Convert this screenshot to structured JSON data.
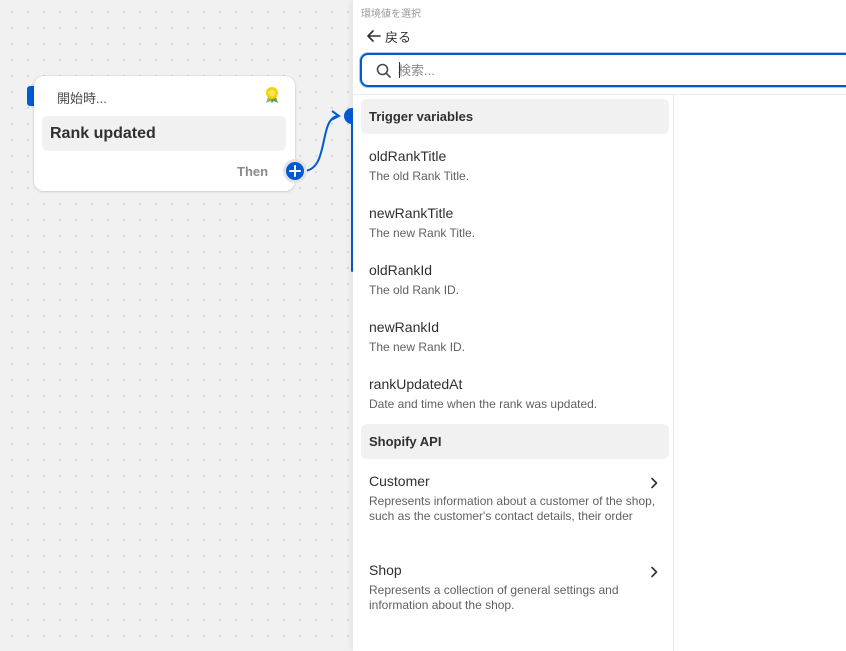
{
  "colors": {
    "accent": "#005bd3",
    "canvas": "#f1f1f1",
    "badge": "#f2d200"
  },
  "trigger": {
    "header_label": "開始時...",
    "title": "Rank updated",
    "then_label": "Then",
    "icon": "award-badge-icon"
  },
  "panel": {
    "hint": "環境値を選択",
    "back_label": "戻る",
    "search": {
      "placeholder": "検索...",
      "value": ""
    },
    "sections": [
      {
        "label": "Trigger variables",
        "items": [
          {
            "name": "oldRankTitle",
            "description": "The old Rank Title."
          },
          {
            "name": "newRankTitle",
            "description": "The new Rank Title."
          },
          {
            "name": "oldRankId",
            "description": "The old Rank ID."
          },
          {
            "name": "newRankId",
            "description": "The new Rank ID."
          },
          {
            "name": "rankUpdatedAt",
            "description": "Date and time when the rank was updated."
          }
        ]
      },
      {
        "label": "Shopify API",
        "items": [
          {
            "name": "Customer",
            "description": "Represents information about a customer of the shop, such as the customer's contact details, their order"
          },
          {
            "name": "Shop",
            "description": "Represents a collection of general settings and information about the shop."
          }
        ]
      }
    ]
  }
}
